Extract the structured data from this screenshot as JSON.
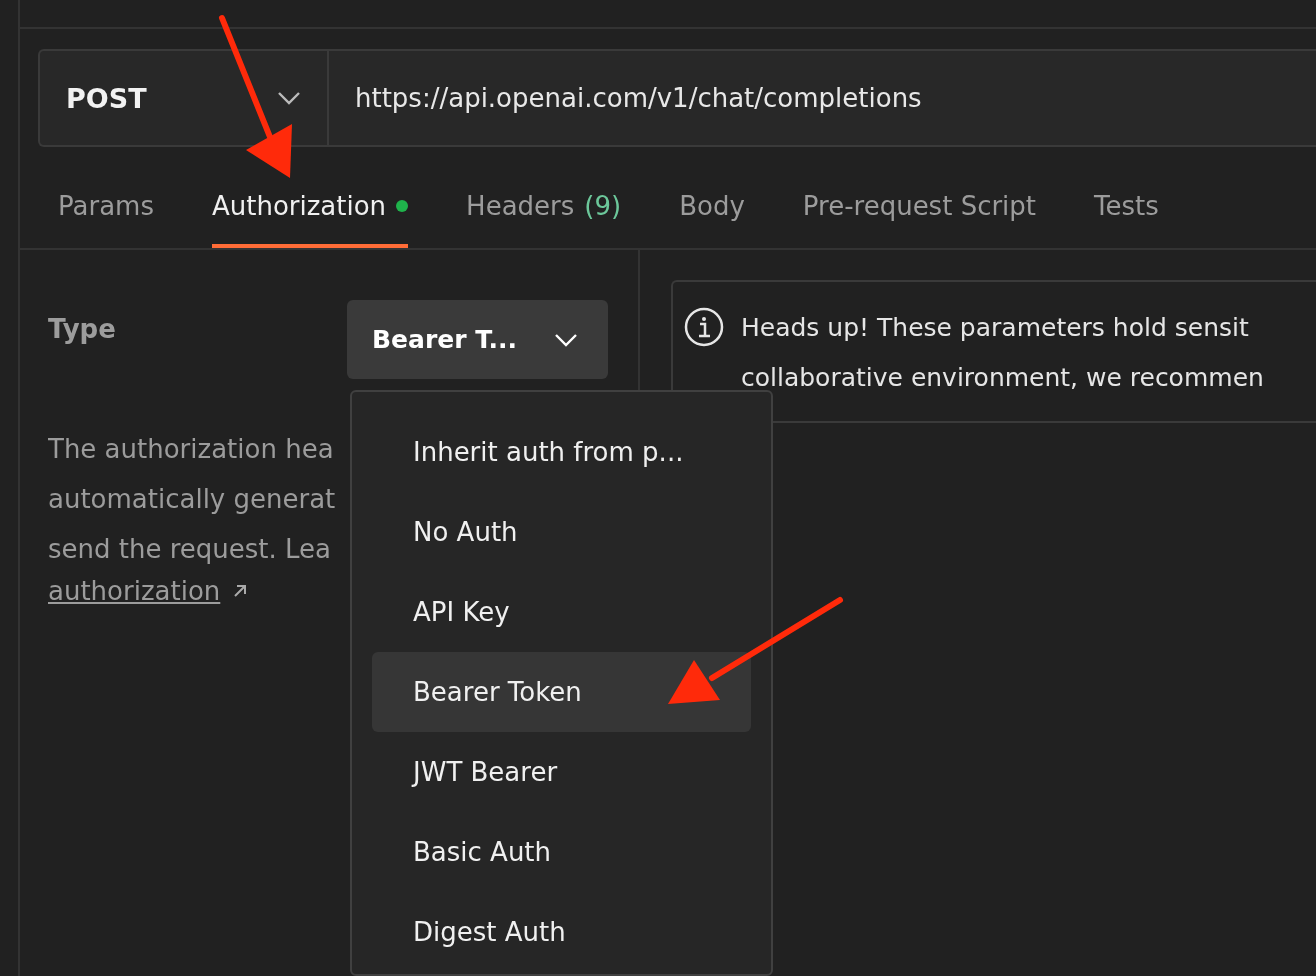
{
  "request": {
    "method": "POST",
    "url": "https://api.openai.com/v1/chat/completions"
  },
  "tabs": [
    {
      "label": "Params",
      "selected": false
    },
    {
      "label": "Authorization",
      "selected": true,
      "indicator": true
    },
    {
      "label": "Headers",
      "count": "(9)",
      "selected": false
    },
    {
      "label": "Body",
      "selected": false
    },
    {
      "label": "Pre-request Script",
      "selected": false
    },
    {
      "label": "Tests",
      "selected": false
    }
  ],
  "auth": {
    "type_label": "Type",
    "type_value": "Bearer T...",
    "description_lines": [
      "The authorization hea",
      "automatically generat",
      "send the request. Lea"
    ],
    "link": "authorization",
    "notice_lines": [
      "Heads up! These parameters hold sensit",
      "collaborative environment, we recommen"
    ]
  },
  "type_menu": [
    {
      "label": "Inherit auth from p...",
      "selected": false
    },
    {
      "label": "No Auth",
      "selected": false
    },
    {
      "label": "API Key",
      "selected": false
    },
    {
      "label": "Bearer Token",
      "selected": true
    },
    {
      "label": "JWT Bearer",
      "selected": false
    },
    {
      "label": "Basic Auth",
      "selected": false
    },
    {
      "label": "Digest Auth",
      "selected": false
    }
  ],
  "annotations": [
    {
      "kind": "arrow"
    },
    {
      "kind": "arrow"
    }
  ]
}
